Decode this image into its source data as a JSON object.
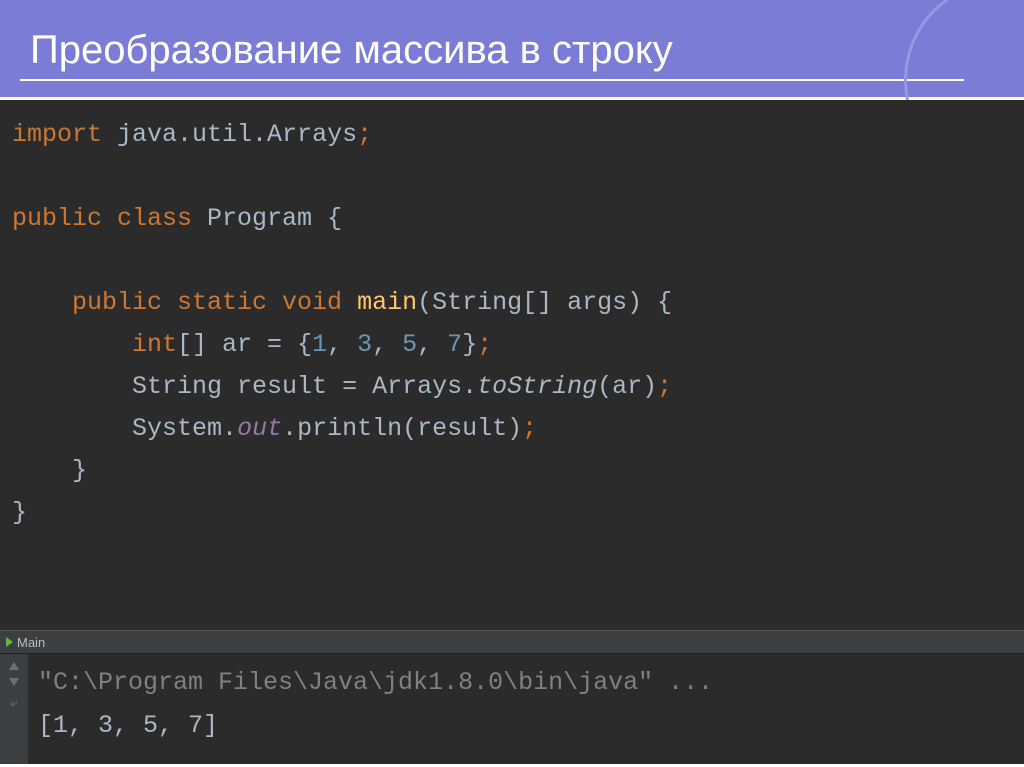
{
  "header": {
    "title": "Преобразование массива в строку"
  },
  "code": {
    "line1": {
      "kw": "import ",
      "pkg": "java.util.Arrays",
      "semi": ";"
    },
    "line3": {
      "kw1": "public class ",
      "cls": "Program ",
      "brace": "{"
    },
    "line5": {
      "indent": "    ",
      "kw": "public static void ",
      "fn": "main",
      "paren": "(",
      "params": "String[] args) {"
    },
    "line6": {
      "indent": "        ",
      "kw": "int",
      "arr": "[] ar = {",
      "n1": "1",
      "c1": ", ",
      "n2": "3",
      "c2": ", ",
      "n3": "5",
      "c3": ", ",
      "n4": "7",
      "close": "}",
      "semi": ";"
    },
    "line7": {
      "indent": "        ",
      "txt1": "String result = Arrays.",
      "meth": "toString",
      "txt2": "(ar)",
      "semi": ";"
    },
    "line8": {
      "indent": "        ",
      "txt1": "System.",
      "field": "out",
      "txt2": ".println(result)",
      "semi": ";"
    },
    "line9": {
      "indent": "    ",
      "brace": "}"
    },
    "line10": {
      "brace": "}"
    }
  },
  "tab": {
    "label": "Main"
  },
  "console": {
    "cmd": "\"C:\\Program Files\\Java\\jdk1.8.0\\bin\\java\" ...",
    "output": "[1, 3, 5, 7]"
  }
}
